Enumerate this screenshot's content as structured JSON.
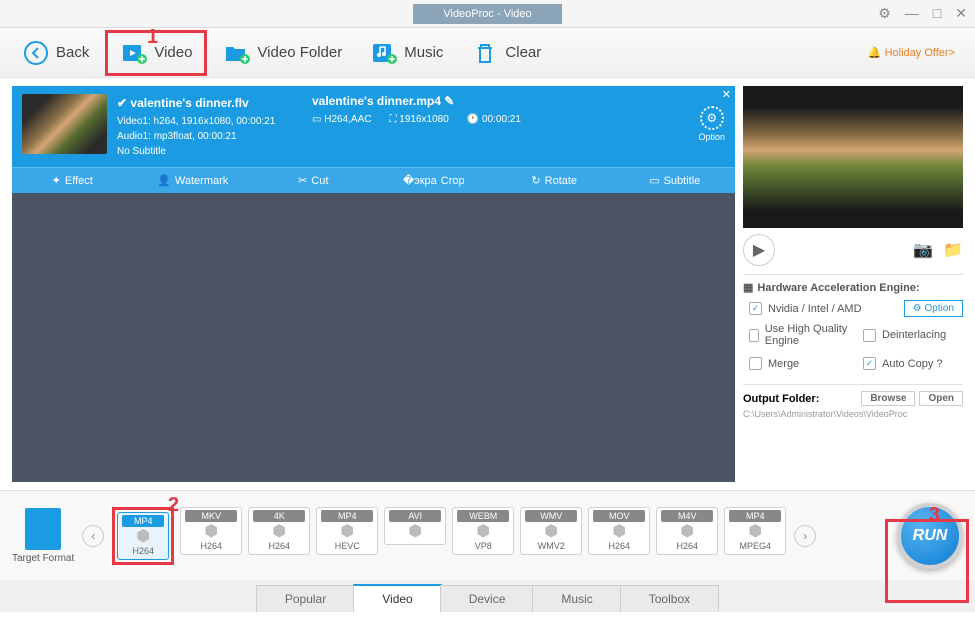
{
  "title": "VideoProc - Video",
  "toolbar": {
    "back": "Back",
    "video": "Video",
    "video_folder": "Video Folder",
    "music": "Music",
    "clear": "Clear",
    "holiday_offer": "Holiday Offer>"
  },
  "file": {
    "source_name": "valentine's dinner.flv",
    "video_line": "Video1: h264, 1916x1080, 00:00:21",
    "audio_line": "Audio1: mp3float, 00:00:21",
    "subtitle_line": "No Subtitle",
    "target_name": "valentine's dinner.mp4",
    "codec": "H264,AAC",
    "resolution": "1916x1080",
    "duration": "00:00:21",
    "option_label": "Option",
    "actions": {
      "effect": "Effect",
      "watermark": "Watermark",
      "cut": "Cut",
      "crop": "Crop",
      "rotate": "Rotate",
      "subtitle": "Subtitle"
    }
  },
  "hw": {
    "title": "Hardware Acceleration Engine:",
    "vendors": "Nvidia / Intel / AMD",
    "option": "Option",
    "hq": "Use High Quality Engine",
    "deint": "Deinterlacing",
    "merge": "Merge",
    "autocopy": "Auto Copy ?"
  },
  "output": {
    "title": "Output Folder:",
    "browse": "Browse",
    "open": "Open",
    "path": "C:\\Users\\Administrator\\Videos\\VideoProc"
  },
  "target_format_label": "Target Format",
  "formats": [
    {
      "top": "MP4",
      "bot": "H264"
    },
    {
      "top": "MKV",
      "bot": "H264"
    },
    {
      "top": "4K",
      "bot": "H264"
    },
    {
      "top": "MP4",
      "bot": "HEVC"
    },
    {
      "top": "AVI",
      "bot": ""
    },
    {
      "top": "WEBM",
      "bot": "VP8"
    },
    {
      "top": "WMV",
      "bot": "WMV2"
    },
    {
      "top": "MOV",
      "bot": "H264"
    },
    {
      "top": "M4V",
      "bot": "H264"
    },
    {
      "top": "MP4",
      "bot": "MPEG4"
    }
  ],
  "run_label": "RUN",
  "tabs": [
    "Popular",
    "Video",
    "Device",
    "Music",
    "Toolbox"
  ],
  "annotations": {
    "a1": "1",
    "a2": "2",
    "a3": "3"
  }
}
